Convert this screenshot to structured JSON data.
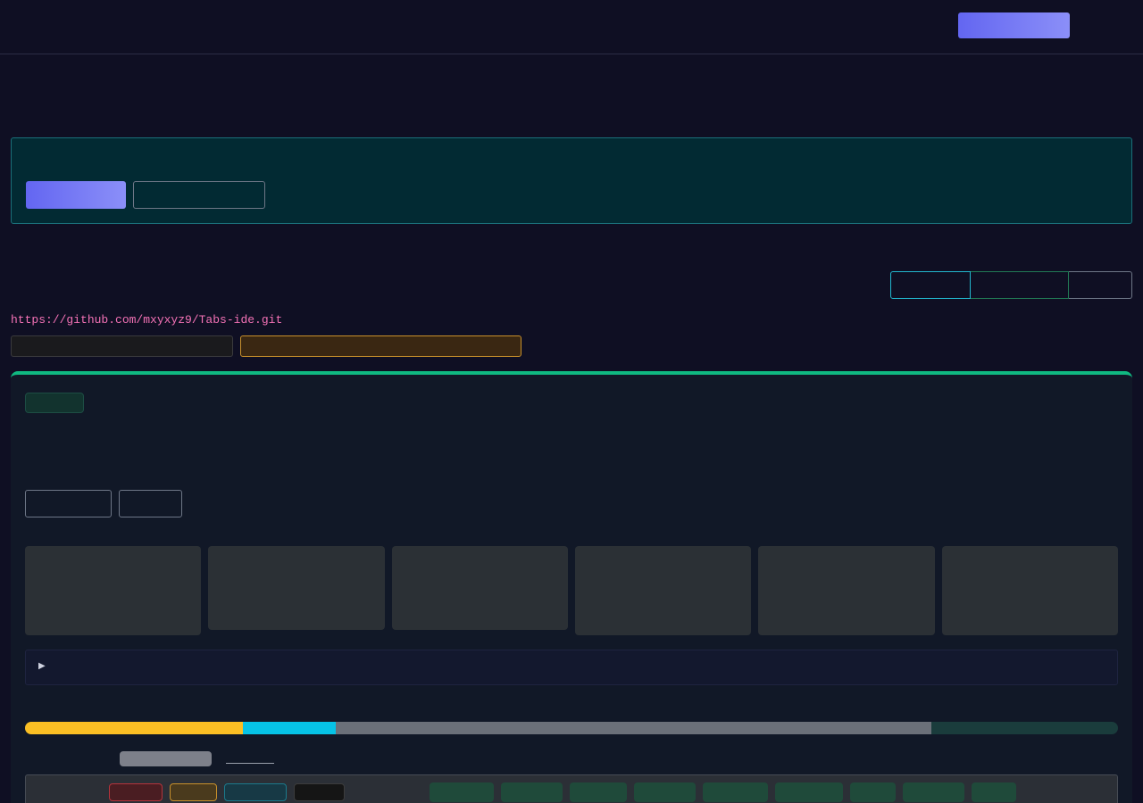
{
  "header": {
    "cta_label": ""
  },
  "banner": {
    "primary_label": "",
    "secondary_label": ""
  },
  "view_toggle": {
    "options": [
      "",
      "",
      ""
    ]
  },
  "repo": {
    "url": "https://github.com/mxyxyz9/Tabs-ide.git",
    "tag_1": "",
    "tag_2": ""
  },
  "panel": {
    "accent_color": "#10b981",
    "badge_label": "",
    "action_1_label": "",
    "action_2_label": "",
    "cards": [
      "",
      "",
      "",
      "",
      "",
      ""
    ],
    "details_icon": "triangle-right-icon",
    "progress_segments": [
      {
        "fraction": 0.199,
        "color": "#fbbf24"
      },
      {
        "fraction": 0.085,
        "color": "#06c3e6"
      },
      {
        "fraction": 0.545,
        "color": "#6b7079"
      }
    ],
    "progress_track_color": "#1a3c3c"
  },
  "toolbar": {
    "status_chips": [
      {
        "bg": "#4a1d22",
        "border": "#b3343c"
      },
      {
        "bg": "#4a3a1d",
        "border": "#c8902b"
      },
      {
        "bg": "#173945",
        "border": "#1b7a8c"
      },
      {
        "bg": "#151515",
        "border": "#3c3c3c"
      }
    ],
    "filter_chip_color": "#1f4a3a"
  }
}
